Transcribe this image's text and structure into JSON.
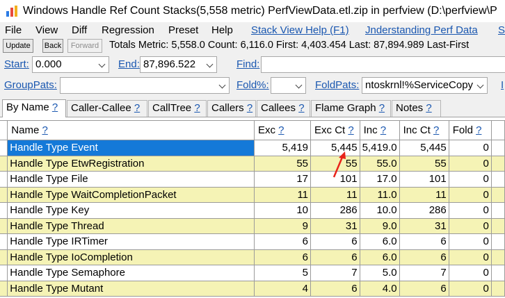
{
  "window": {
    "title": "Windows Handle Ref Count Stacks(5,558 metric) PerfViewData.etl.zip in perfview (D:\\perfview\\P"
  },
  "menu": {
    "items": [
      "File",
      "View",
      "Diff",
      "Regression",
      "Preset",
      "Help"
    ],
    "links": [
      "Stack View Help (F1)",
      "Jnderstanding Perf Data",
      "S"
    ]
  },
  "toolbar": {
    "update_label": "Update",
    "back_label": "Back",
    "forward_label": "Forward",
    "totals": "Totals Metric: 5,558.0  Count: 6,116.0  First: 4,403.454 Last: 87,894.989  Last-First"
  },
  "filters": {
    "start_label": "Start:",
    "start_value": "0.000",
    "end_label": "End:",
    "end_value": "87,896.522",
    "find_label": "Find:",
    "find_value": "",
    "grouppats_label": "GroupPats:",
    "grouppats_value": "",
    "fold_label": "Fold%:",
    "fold_value": "",
    "foldpats_label": "FoldPats:",
    "foldpats_value": "ntoskrnl!%ServiceCopy",
    "trailing_label": "I"
  },
  "tabs": [
    {
      "label": "By Name",
      "help": "?"
    },
    {
      "label": "Caller-Callee",
      "help": "?"
    },
    {
      "label": "CallTree",
      "help": "?"
    },
    {
      "label": "Callers",
      "help": "?"
    },
    {
      "label": "Callees",
      "help": "?"
    },
    {
      "label": "Flame Graph",
      "help": "?"
    },
    {
      "label": "Notes",
      "help": "?"
    }
  ],
  "table": {
    "columns": [
      {
        "label": "Name",
        "help": "?"
      },
      {
        "label": "Exc",
        "help": "?"
      },
      {
        "label": "Exc Ct",
        "help": "?"
      },
      {
        "label": "Inc",
        "help": "?"
      },
      {
        "label": "Inc Ct",
        "help": "?"
      },
      {
        "label": "Fold",
        "help": "?"
      }
    ],
    "rows": [
      [
        "Handle Type Event",
        "5,419",
        "5,445",
        "5,419.0",
        "5,445",
        "0"
      ],
      [
        "Handle Type EtwRegistration",
        "55",
        "55",
        "55.0",
        "55",
        "0"
      ],
      [
        "Handle Type File",
        "17",
        "101",
        "17.0",
        "101",
        "0"
      ],
      [
        "Handle Type WaitCompletionPacket",
        "11",
        "11",
        "11.0",
        "11",
        "0"
      ],
      [
        "Handle Type Key",
        "10",
        "286",
        "10.0",
        "286",
        "0"
      ],
      [
        "Handle Type Thread",
        "9",
        "31",
        "9.0",
        "31",
        "0"
      ],
      [
        "Handle Type IRTimer",
        "6",
        "6",
        "6.0",
        "6",
        "0"
      ],
      [
        "Handle Type IoCompletion",
        "6",
        "6",
        "6.0",
        "6",
        "0"
      ],
      [
        "Handle Type Semaphore",
        "5",
        "7",
        "5.0",
        "7",
        "0"
      ],
      [
        "Handle Type Mutant",
        "4",
        "6",
        "4.0",
        "6",
        "0"
      ]
    ]
  },
  "colors": {
    "link": "#1a57b0",
    "row_highlight": "#f5f3b5",
    "selection": "#1479d8",
    "annotation_arrow": "#e8231a"
  }
}
